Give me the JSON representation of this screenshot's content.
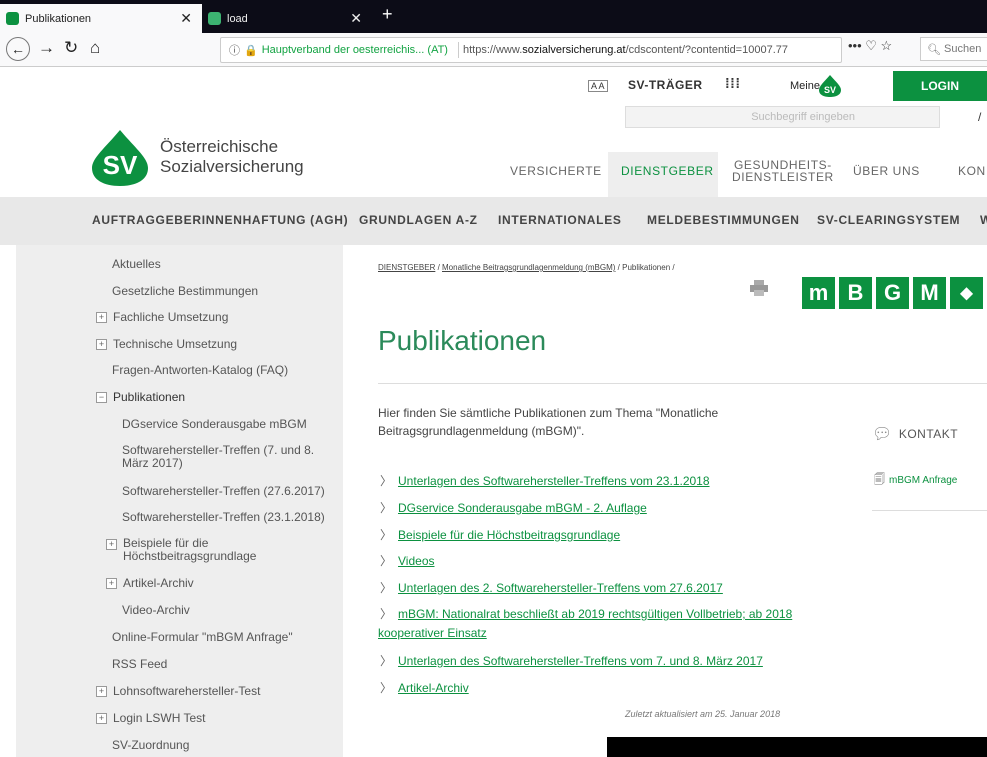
{
  "browser": {
    "tabs": [
      {
        "label": "Publikationen",
        "active": true
      },
      {
        "label": "load",
        "active": false
      }
    ],
    "site_identity": "Hauptverband der oesterreichis... (AT)",
    "url_prefix": "https://www.",
    "url_domain": "sozialversicherung.at",
    "url_rest": "/cdscontent/?contentid=10007.77",
    "search_placeholder": "Suchen"
  },
  "header": {
    "logo_line1": "Österreichische",
    "logo_line2": "Sozialversicherung",
    "logo_letters": "SV",
    "aa": "A A",
    "sv_traeger": "SV-TRÄGER",
    "meine": "Meine",
    "login": "LOGIN",
    "search_placeholder": "Suchbegriff eingeben",
    "main_nav": [
      {
        "label": "VERSICHERTE"
      },
      {
        "label": "DIENSTGEBER"
      },
      {
        "label": "GESUNDHEITS-\nDIENSTLEISTER"
      },
      {
        "label": "ÜBER UNS"
      },
      {
        "label": "KON"
      }
    ]
  },
  "subnav": [
    "AUFTRAGGEBERINNENHAFTUNG (AGH)",
    "GRUNDLAGEN A-Z",
    "INTERNATIONALES",
    "MELDEBESTIMMUNGEN",
    "SV-CLEARINGSYSTEM",
    "W"
  ],
  "sidebar": [
    {
      "label": "Aktuelles",
      "plus": false,
      "sign": ""
    },
    {
      "label": "Gesetzliche Bestimmungen",
      "plus": false,
      "sign": ""
    },
    {
      "label": "Fachliche Umsetzung",
      "plus": true,
      "sign": "+"
    },
    {
      "label": "Technische Umsetzung",
      "plus": true,
      "sign": "+"
    },
    {
      "label": "Fragen-Antworten-Katalog (FAQ)",
      "plus": false,
      "sign": ""
    },
    {
      "label": "Publikationen",
      "plus": true,
      "sign": "−"
    },
    {
      "label": "DGservice Sonderausgabe mBGM",
      "plus": false,
      "sign": ""
    },
    {
      "label": "Softwarehersteller-Treffen (7. und 8.\nMärz 2017)",
      "plus": false,
      "sign": ""
    },
    {
      "label": "Softwarehersteller-Treffen (27.6.2017)",
      "plus": false,
      "sign": ""
    },
    {
      "label": "Softwarehersteller-Treffen (23.1.2018)",
      "plus": false,
      "sign": ""
    },
    {
      "label": "Beispiele für die\nHöchstbeitragsgrundlage",
      "plus": true,
      "sign": "+"
    },
    {
      "label": "Artikel-Archiv",
      "plus": true,
      "sign": "+"
    },
    {
      "label": "Video-Archiv",
      "plus": false,
      "sign": ""
    },
    {
      "label": "Online-Formular \"mBGM Anfrage\"",
      "plus": false,
      "sign": ""
    },
    {
      "label": "RSS Feed",
      "plus": false,
      "sign": ""
    },
    {
      "label": "Lohnsoftwarehersteller-Test",
      "plus": true,
      "sign": "+"
    },
    {
      "label": "Login LSWH Test",
      "plus": true,
      "sign": "+"
    },
    {
      "label": "SV-Zuordnung",
      "plus": false,
      "sign": ""
    }
  ],
  "content": {
    "breadcrumb_1": "DIENSTGEBER",
    "breadcrumb_sep": " / ",
    "breadcrumb_2": "Monatliche Beitragsgrundlagenmeldung (mBGM)",
    "breadcrumb_3": " / Publikationen /",
    "mbgm_letters": [
      "m",
      "B",
      "G",
      "M"
    ],
    "title": "Publikationen",
    "intro": "Hier finden Sie sämtliche Publikationen zum Thema \"Monatliche Beitragsgrundlagenmeldung (mBGM)\".",
    "links": [
      "Unterlagen des Softwarehersteller-Treffens vom 23.1.2018",
      "DGservice Sonderausgabe mBGM - 2. Auflage",
      "Beispiele für die Höchstbeitragsgrundlage",
      "Videos",
      "Unterlagen des 2. Softwarehersteller-Treffens vom 27.6.2017",
      "mBGM: Nationalrat beschließt ab 2019 rechtsgültigen Vollbetrieb; ab 2018",
      "Unterlagen des Softwarehersteller-Treffens vom 7. und 8. März 2017",
      "Artikel-Archiv"
    ],
    "link6_cont": "kooperativer Einsatz",
    "kontakt": "KONTAKT",
    "anfrage": "mBGM Anfrage",
    "updated": "Zuletzt aktualisiert am 25. Januar 2018"
  },
  "colors": {
    "brand_green": "#0c9140",
    "title_green": "#2b8a5a"
  }
}
